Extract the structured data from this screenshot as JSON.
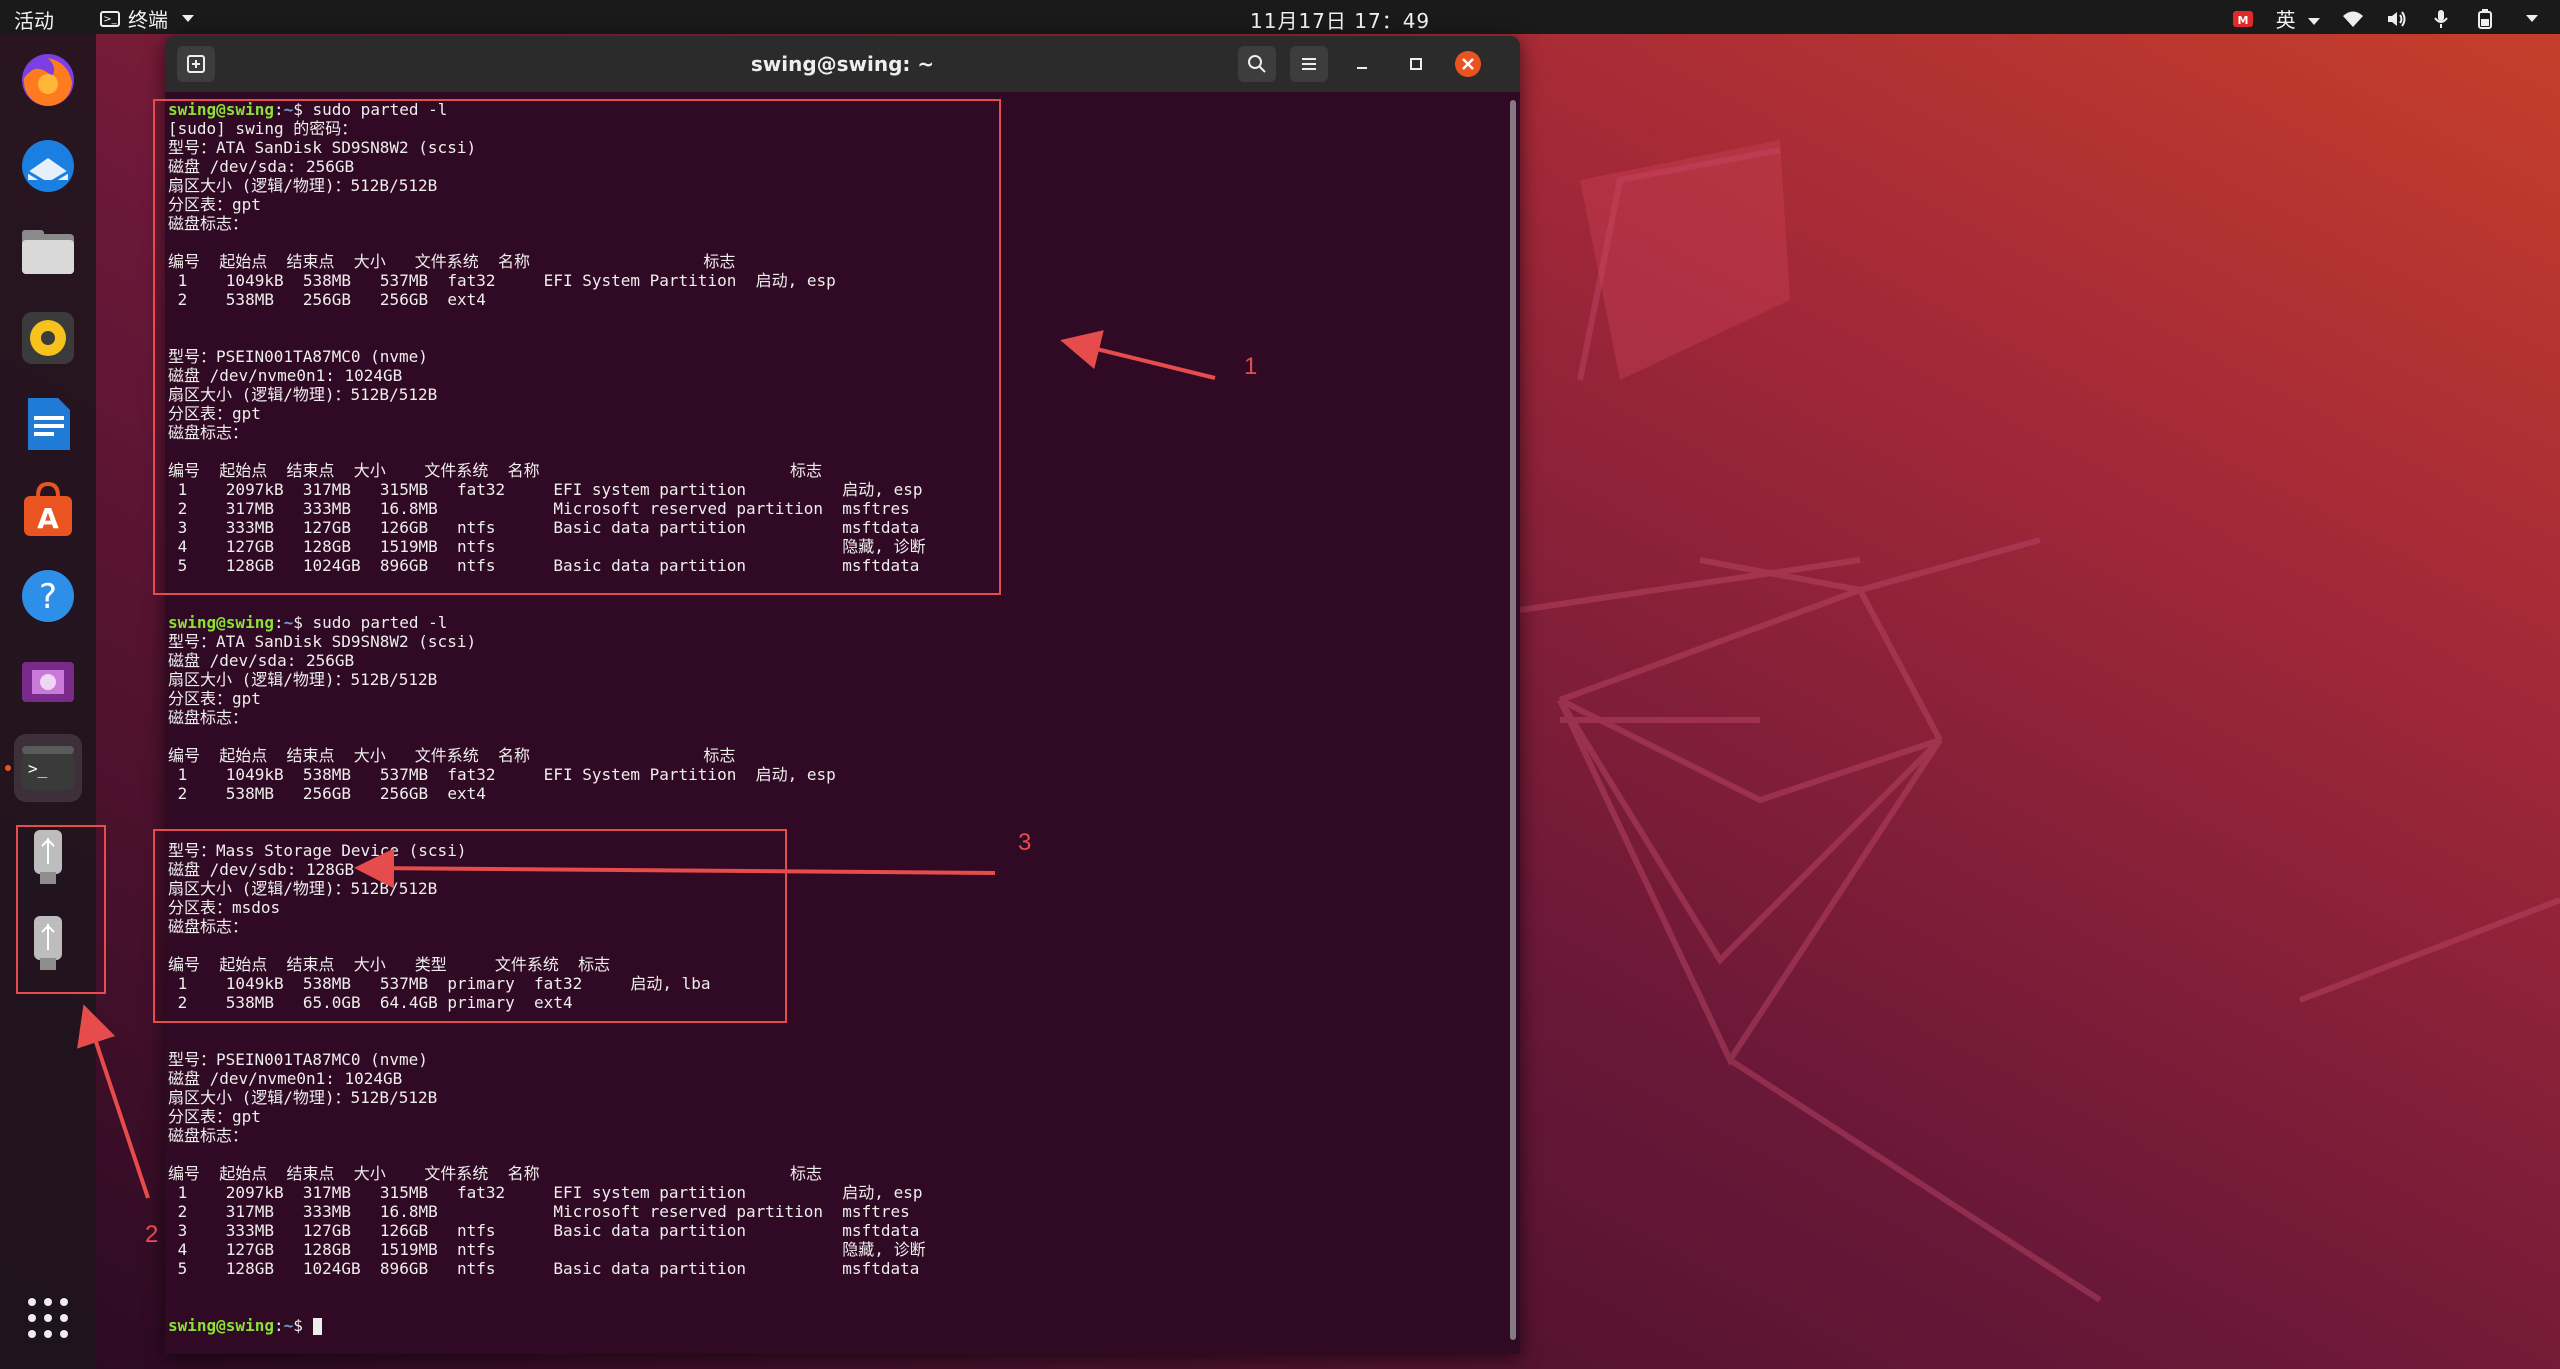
{
  "topbar": {
    "activities": "活动",
    "app_name": "终端",
    "clock": "11月17日  17：49",
    "input_method": "英"
  },
  "dock": {
    "items": [
      {
        "name": "firefox"
      },
      {
        "name": "thunderbird"
      },
      {
        "name": "files"
      },
      {
        "name": "rhythmbox"
      },
      {
        "name": "libreoffice-writer"
      },
      {
        "name": "ubuntu-software"
      },
      {
        "name": "help"
      },
      {
        "name": "shotwell"
      },
      {
        "name": "terminal"
      },
      {
        "name": "usb-drive-1"
      },
      {
        "name": "usb-drive-2"
      },
      {
        "name": "show-applications"
      }
    ]
  },
  "terminal": {
    "title": "swing@swing: ~",
    "prompt_user": "swing@swing",
    "prompt_path": "~",
    "lines": [
      {
        "p": true,
        "text": "$ sudo parted -l"
      },
      {
        "text": "[sudo] swing 的密码："
      },
      {
        "text": "型号：ATA SanDisk SD9SN8W2 (scsi)"
      },
      {
        "text": "磁盘 /dev/sda: 256GB"
      },
      {
        "text": "扇区大小 (逻辑/物理)：512B/512B"
      },
      {
        "text": "分区表：gpt"
      },
      {
        "text": "磁盘标志："
      },
      {
        "text": ""
      },
      {
        "text": "编号  起始点  结束点  大小   文件系统  名称                  标志"
      },
      {
        "text": " 1    1049kB  538MB   537MB  fat32     EFI System Partition  启动, esp"
      },
      {
        "text": " 2    538MB   256GB   256GB  ext4"
      },
      {
        "text": ""
      },
      {
        "text": ""
      },
      {
        "text": "型号：PSEIN001TA87MC0 (nvme)"
      },
      {
        "text": "磁盘 /dev/nvme0n1: 1024GB"
      },
      {
        "text": "扇区大小 (逻辑/物理)：512B/512B"
      },
      {
        "text": "分区表：gpt"
      },
      {
        "text": "磁盘标志："
      },
      {
        "text": ""
      },
      {
        "text": "编号  起始点  结束点  大小    文件系统  名称                          标志"
      },
      {
        "text": " 1    2097kB  317MB   315MB   fat32     EFI system partition          启动, esp"
      },
      {
        "text": " 2    317MB   333MB   16.8MB            Microsoft reserved partition  msftres"
      },
      {
        "text": " 3    333MB   127GB   126GB   ntfs      Basic data partition          msftdata"
      },
      {
        "text": " 4    127GB   128GB   1519MB  ntfs                                    隐藏, 诊断"
      },
      {
        "text": " 5    128GB   1024GB  896GB   ntfs      Basic data partition          msftdata"
      },
      {
        "text": ""
      },
      {
        "text": ""
      },
      {
        "p": true,
        "text": "$ sudo parted -l"
      },
      {
        "text": "型号：ATA SanDisk SD9SN8W2 (scsi)"
      },
      {
        "text": "磁盘 /dev/sda: 256GB"
      },
      {
        "text": "扇区大小 (逻辑/物理)：512B/512B"
      },
      {
        "text": "分区表：gpt"
      },
      {
        "text": "磁盘标志："
      },
      {
        "text": ""
      },
      {
        "text": "编号  起始点  结束点  大小   文件系统  名称                  标志"
      },
      {
        "text": " 1    1049kB  538MB   537MB  fat32     EFI System Partition  启动, esp"
      },
      {
        "text": " 2    538MB   256GB   256GB  ext4"
      },
      {
        "text": ""
      },
      {
        "text": ""
      },
      {
        "text": "型号：Mass Storage Device (scsi)"
      },
      {
        "text": "磁盘 /dev/sdb: 128GB"
      },
      {
        "text": "扇区大小 (逻辑/物理)：512B/512B"
      },
      {
        "text": "分区表：msdos"
      },
      {
        "text": "磁盘标志："
      },
      {
        "text": ""
      },
      {
        "text": "编号  起始点  结束点  大小   类型     文件系统  标志"
      },
      {
        "text": " 1    1049kB  538MB   537MB  primary  fat32     启动, lba"
      },
      {
        "text": " 2    538MB   65.0GB  64.4GB primary  ext4"
      },
      {
        "text": ""
      },
      {
        "text": ""
      },
      {
        "text": "型号：PSEIN001TA87MC0 (nvme)"
      },
      {
        "text": "磁盘 /dev/nvme0n1: 1024GB"
      },
      {
        "text": "扇区大小 (逻辑/物理)：512B/512B"
      },
      {
        "text": "分区表：gpt"
      },
      {
        "text": "磁盘标志："
      },
      {
        "text": ""
      },
      {
        "text": "编号  起始点  结束点  大小    文件系统  名称                          标志"
      },
      {
        "text": " 1    2097kB  317MB   315MB   fat32     EFI system partition          启动, esp"
      },
      {
        "text": " 2    317MB   333MB   16.8MB            Microsoft reserved partition  msftres"
      },
      {
        "text": " 3    333MB   127GB   126GB   ntfs      Basic data partition          msftdata"
      },
      {
        "text": " 4    127GB   128GB   1519MB  ntfs                                    隐藏, 诊断"
      },
      {
        "text": " 5    128GB   1024GB  896GB   ntfs      Basic data partition          msftdata"
      },
      {
        "text": ""
      },
      {
        "text": ""
      },
      {
        "p": true,
        "text": "$ ",
        "cursor": true
      }
    ]
  },
  "annotations": {
    "labels": [
      "1",
      "2",
      "3"
    ],
    "color": "#e74c4c"
  }
}
